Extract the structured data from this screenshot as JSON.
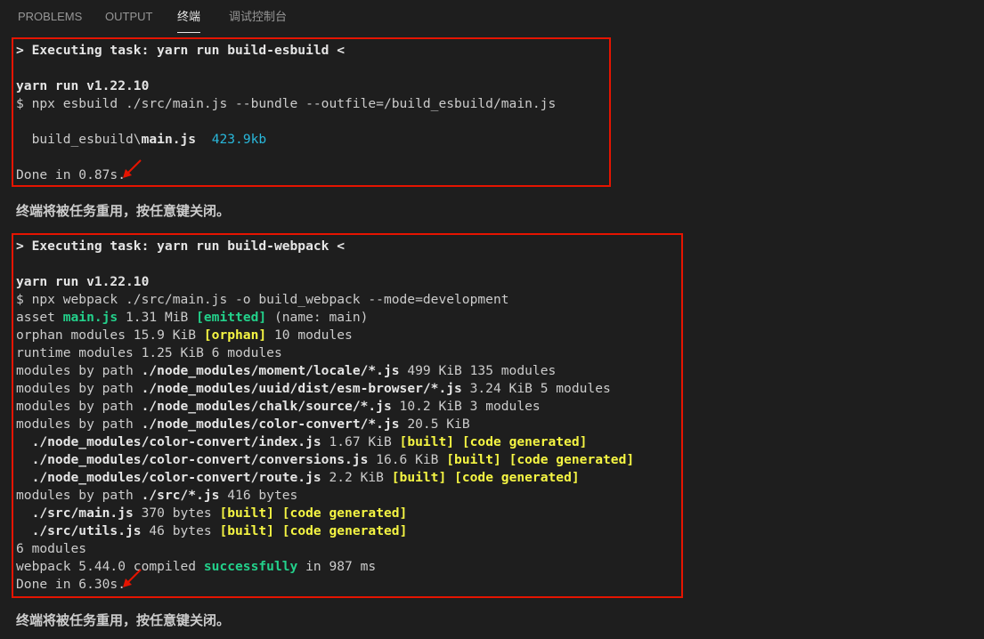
{
  "tabs": [
    {
      "label": "PROBLEMS"
    },
    {
      "label": "OUTPUT"
    },
    {
      "label": "终端"
    },
    {
      "label": "调试控制台"
    }
  ],
  "esbuild": {
    "task": "> Executing task: yarn run build-esbuild <",
    "yarn": "yarn run v1.22.10",
    "cmd": "$ npx esbuild ./src/main.js --bundle --outfile=/build_esbuild/main.js",
    "out_path_prefix": "  build_esbuild\\",
    "out_file": "main.js",
    "out_size": "423.9kb",
    "done": "Done in 0.87s."
  },
  "reuse_note": "终端将被任务重用，按任意键关闭。",
  "webpack": {
    "task": "> Executing task: yarn run build-webpack <",
    "yarn": "yarn run v1.22.10",
    "cmd": "$ npx webpack ./src/main.js -o build_webpack --mode=development",
    "asset": {
      "pre": "asset ",
      "name": "main.js",
      "size": " 1.31 MiB ",
      "tag": "[emitted]",
      "post": " (name: main)"
    },
    "orphan": {
      "pre": "orphan modules 15.9 KiB ",
      "tag": "[orphan]",
      "post": " 10 modules"
    },
    "runtime": "runtime modules 1.25 KiB 6 modules",
    "paths": [
      {
        "pre": "modules by path ",
        "path": "./node_modules/moment/locale/*.js",
        "post": " 499 KiB 135 modules"
      },
      {
        "pre": "modules by path ",
        "path": "./node_modules/uuid/dist/esm-browser/*.js",
        "post": " 3.24 KiB 5 modules"
      },
      {
        "pre": "modules by path ",
        "path": "./node_modules/chalk/source/*.js",
        "post": " 10.2 KiB 3 modules"
      },
      {
        "pre": "modules by path ",
        "path": "./node_modules/color-convert/*.js",
        "post": " 20.5 KiB"
      }
    ],
    "cc_files": [
      {
        "path": "  ./node_modules/color-convert/index.js",
        "size": " 1.67 KiB "
      },
      {
        "path": "  ./node_modules/color-convert/conversions.js",
        "size": " 16.6 KiB "
      },
      {
        "path": "  ./node_modules/color-convert/route.js",
        "size": " 2.2 KiB "
      }
    ],
    "src": {
      "pre": "modules by path ",
      "path": "./src/*.js",
      "post": " 416 bytes"
    },
    "src_files": [
      {
        "path": "  ./src/main.js",
        "size": " 370 bytes "
      },
      {
        "path": "  ./src/utils.js",
        "size": " 46 bytes "
      }
    ],
    "built_tag": "[built]",
    "gen_tag": "[code generated]",
    "modules_count": "6 modules",
    "compiled": {
      "pre": "webpack 5.44.0 compiled ",
      "word": "successfully",
      "post": " in 987 ms"
    },
    "done": "Done in 6.30s."
  },
  "colors": {
    "highlight_box": "#e51400",
    "success": "#23d18b",
    "tag": "#f5f543",
    "size": "#29b8db"
  }
}
